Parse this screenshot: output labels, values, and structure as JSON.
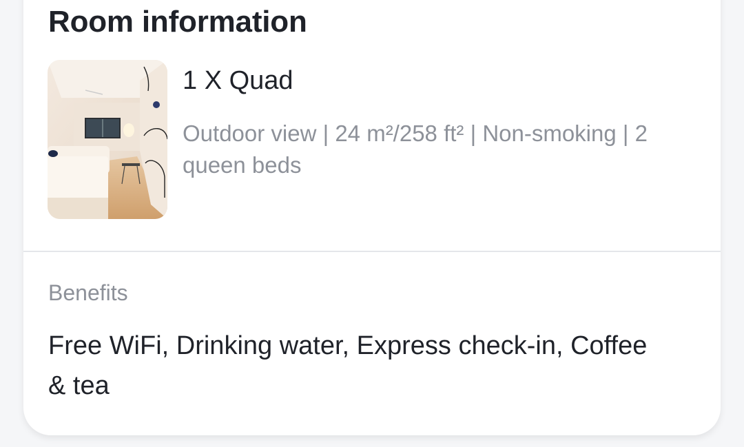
{
  "room_info": {
    "title": "Room information",
    "photo_icon": "room-photo",
    "room_name": "1 X Quad",
    "details": "Outdoor view | 24 m²/258 ft² | Non-smoking | 2 queen beds"
  },
  "benefits": {
    "label": "Benefits",
    "text": "Free WiFi, Drinking water, Express check-in, Coffee & tea"
  }
}
